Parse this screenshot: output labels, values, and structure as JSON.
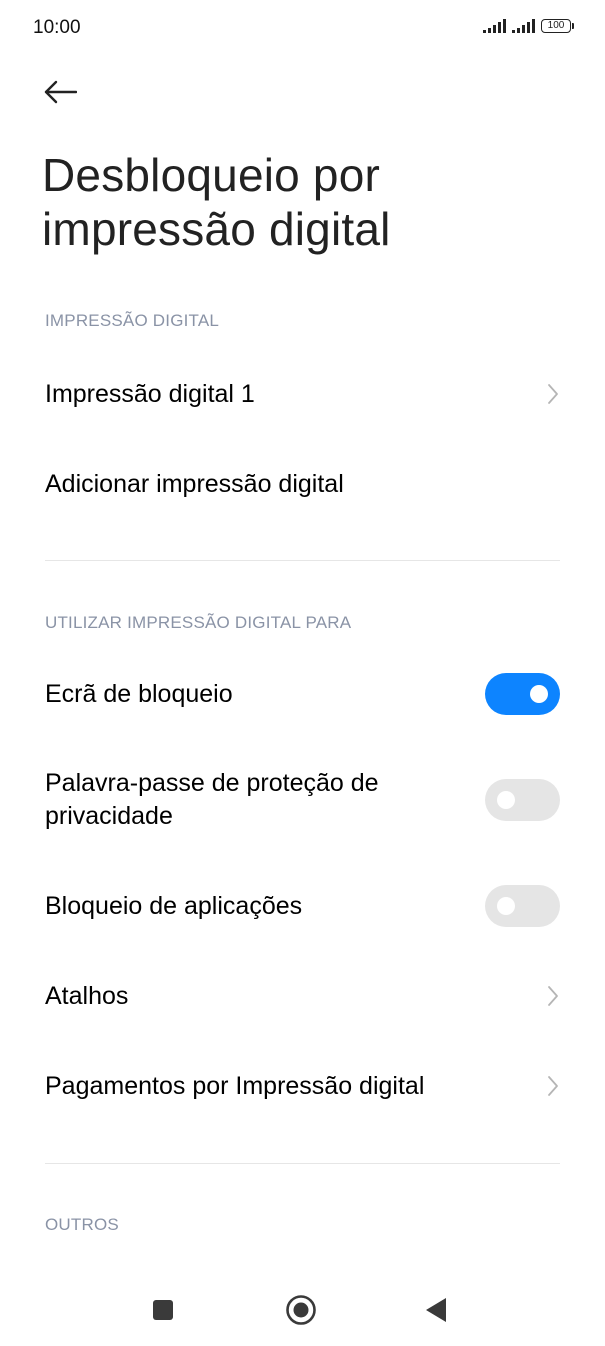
{
  "status_bar": {
    "time": "10:00",
    "battery": "100",
    "icons": [
      "signal-icon",
      "signal-icon",
      "battery-icon"
    ]
  },
  "header": {
    "back_icon": "back-arrow-icon",
    "title": "Desbloqueio por impressão digital"
  },
  "sections": {
    "fingerprint": {
      "header": "IMPRESSÃO DIGITAL",
      "items": [
        {
          "label": "Impressão digital 1",
          "control": "chevron"
        },
        {
          "label": "Adicionar impressão digital",
          "control": "none"
        }
      ]
    },
    "use_for": {
      "header": "UTILIZAR IMPRESSÃO DIGITAL PARA",
      "items": [
        {
          "label": "Ecrã de bloqueio",
          "control": "toggle",
          "state": "on"
        },
        {
          "label": "Palavra-passe de proteção de privacidade",
          "control": "toggle",
          "state": "off"
        },
        {
          "label": "Bloqueio de aplicações",
          "control": "toggle",
          "state": "off"
        },
        {
          "label": "Atalhos",
          "control": "chevron"
        },
        {
          "label": "Pagamentos por Impressão digital",
          "control": "chevron"
        }
      ]
    },
    "others": {
      "header": "OUTROS"
    }
  },
  "nav_bar": {
    "icons": [
      "recents-square-icon",
      "home-circle-icon",
      "back-triangle-icon"
    ]
  },
  "colors": {
    "accent": "#0d84ff",
    "section_header": "#8a93a6",
    "toggle_off": "#e5e5e5",
    "divider": "#e6e6e6"
  }
}
